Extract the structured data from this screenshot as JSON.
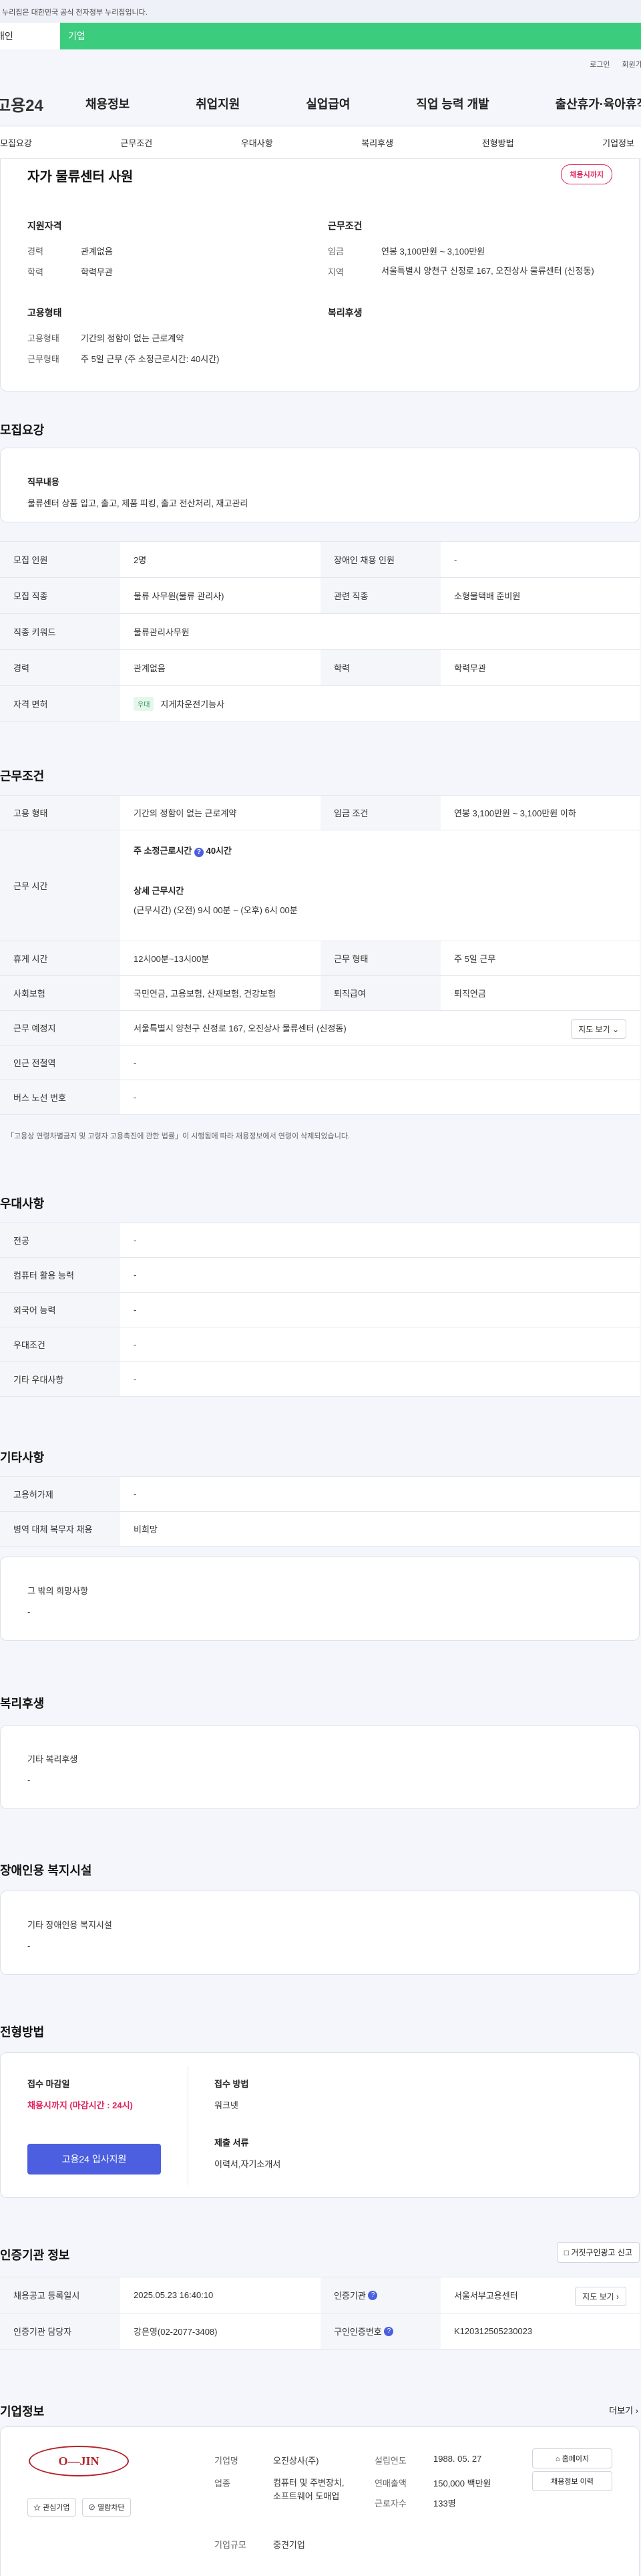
{
  "header": {
    "gov_notice": "이 누리집은 대한민국 공식 전자정부 누리집입니다.",
    "user_tabs": [
      "개인",
      "기업"
    ],
    "util": [
      "로그인",
      "회원가입"
    ],
    "logo": "고용24",
    "gnb": [
      "채용정보",
      "취업지원",
      "실업급여",
      "직업 능력 개발",
      "출산휴가·육아휴직"
    ]
  },
  "subnav": [
    "모집요강",
    "근무조건",
    "우대사항",
    "복리후생",
    "전형방법",
    "기업정보"
  ],
  "job": {
    "title": "자가 물류센터 사원",
    "deadline_badge": "채용시까지",
    "qual_title": "지원자격",
    "career_label": "경력",
    "career": "관계없음",
    "edu_label": "학력",
    "edu": "학력무관",
    "cond_title": "근무조건",
    "wage_label": "임금",
    "wage": "연봉 3,100만원 ~ 3,100만원",
    "region_label": "지역",
    "region": "서울특별시 양천구 신정로 167, 오진상사 물류센터 (신정동)",
    "emp_title": "고용형태",
    "emp_label": "고용형태",
    "emp": "기간의 정함이 없는 근로계약",
    "hours_label": "근무형태",
    "hours": "주 5일 근무 (주 소정근로시간: 40시간)",
    "welfare_title": "복리후생"
  },
  "recruit": {
    "title": "모집요강",
    "duty_label": "직무내용",
    "duty": "물류센터 상품 입고, 출고, 제품 피킹, 출고 전산처리, 재고관리",
    "rows": [
      {
        "k1": "모집 인원",
        "v1": "2명",
        "k2": "장애인 채용 인원",
        "v2": "-"
      },
      {
        "k1": "모집 직종",
        "v1": "물류 사무원(물류 관리사)",
        "k2": "관련 직종",
        "v2": "소형물택배 준비원"
      },
      {
        "k1": "직종 키워드",
        "v1": "물류관리사무원",
        "k2": "",
        "v2": ""
      },
      {
        "k1": "경력",
        "v1": "관계없음",
        "k2": "학력",
        "v2": "학력무관"
      }
    ],
    "license_label": "자격 면허",
    "license_badge": "우대",
    "license": "지게차운전기능사"
  },
  "work": {
    "title": "근무조건",
    "type_label": "고용 형태",
    "type": "기간의 정함이 없는 근로계약",
    "wage_label": "임금 조건",
    "wage": "연봉 3,100만원 ~ 3,100만원 이하",
    "time_label": "근무 시간",
    "week_hours_label": "주 소정근로시간",
    "week_hours": "40시간",
    "detail_label": "상세 근무시간",
    "detail": "(근무시간) (오전) 9시 00분 ~ (오후) 6시 00분",
    "break_label": "휴게 시간",
    "break": "12시00분~13시00분",
    "form_label": "근무 형태",
    "form": "주 5일 근무",
    "ins_label": "사회보험",
    "ins": "국민연금, 고용보험, 산재보험, 건강보험",
    "ret_label": "퇴직급여",
    "ret": "퇴직연금",
    "place_label": "근무 예정지",
    "place": "서울특별시 양천구 신정로 167, 오진상사 물류센터 (신정동)",
    "map_btn": "지도 보기",
    "station_label": "인근 전철역",
    "station": "-",
    "bus_label": "버스 노선 번호",
    "bus": "-",
    "note": "「고용상 연령차별금지 및 고령자 고용촉진에 관한 법률」이 시행됨에 따라 채용정보에서 연령이 삭제되었습니다."
  },
  "pref": {
    "title": "우대사항",
    "rows": [
      {
        "k": "전공",
        "v": "-"
      },
      {
        "k": "컴퓨터 활용 능력",
        "v": "-"
      },
      {
        "k": "외국어 능력",
        "v": "-"
      },
      {
        "k": "우대조건",
        "v": "-"
      },
      {
        "k": "기타 우대사항",
        "v": "-"
      }
    ]
  },
  "etc": {
    "title": "기타사항",
    "rows": [
      {
        "k": "고용허가제",
        "v": "-"
      },
      {
        "k": "병역 대체 복무자 채용",
        "v": "비희망"
      }
    ],
    "wish_label": "그 밖의 희망사항",
    "wish": "-"
  },
  "welfare": {
    "title": "복리후생",
    "label": "기타 복리후생",
    "value": "-"
  },
  "disabled": {
    "title": "장애인용 복지시설",
    "label": "기타 장애인용 복지시설",
    "value": "-"
  },
  "selection": {
    "title": "전형방법",
    "deadline_label": "접수 마감일",
    "deadline": "채용시까지 (마감시간 : 24시)",
    "apply_btn": "고용24 입사지원",
    "method_label": "접수 방법",
    "method": "워크넷",
    "docs_label": "제출 서류",
    "docs": "이력서,자기소개서"
  },
  "cert": {
    "title": "인증기관 정보",
    "report_btn": "거짓구인광고 신고",
    "reg_label": "채용공고 등록일시",
    "reg": "2025.05.23 16:40:10",
    "org_label": "인증기관",
    "org": "서울서부고용센터",
    "map_btn": "지도 보기",
    "manager_label": "인증기관 담당자",
    "manager": "강은영(02-2077-3408)",
    "no_label": "구인인증번호",
    "no": "K120312505230023"
  },
  "company": {
    "title": "기업정보",
    "more": "더보기",
    "logo_text": "O—JIN",
    "fav_btn": "관심기업",
    "block_btn": "열람차단",
    "name_label": "기업명",
    "name": "오진상사(주)",
    "est_label": "설립연도",
    "est": "1988. 05. 27",
    "home_btn": "홈페이지",
    "ind_label": "업종",
    "ind": "컴퓨터 및 주변장치, 소프트웨어 도매업",
    "sales_label": "연매출액",
    "sales": "150,000 백만원",
    "history_btn": "채용정보 이력",
    "emp_label": "근로자수",
    "emp": "133명",
    "size_label": "기업규모",
    "size": "중견기업"
  },
  "colors": {
    "accent": "#3ccc7e",
    "primary": "#4b5fe0",
    "danger": "#e0245e"
  }
}
